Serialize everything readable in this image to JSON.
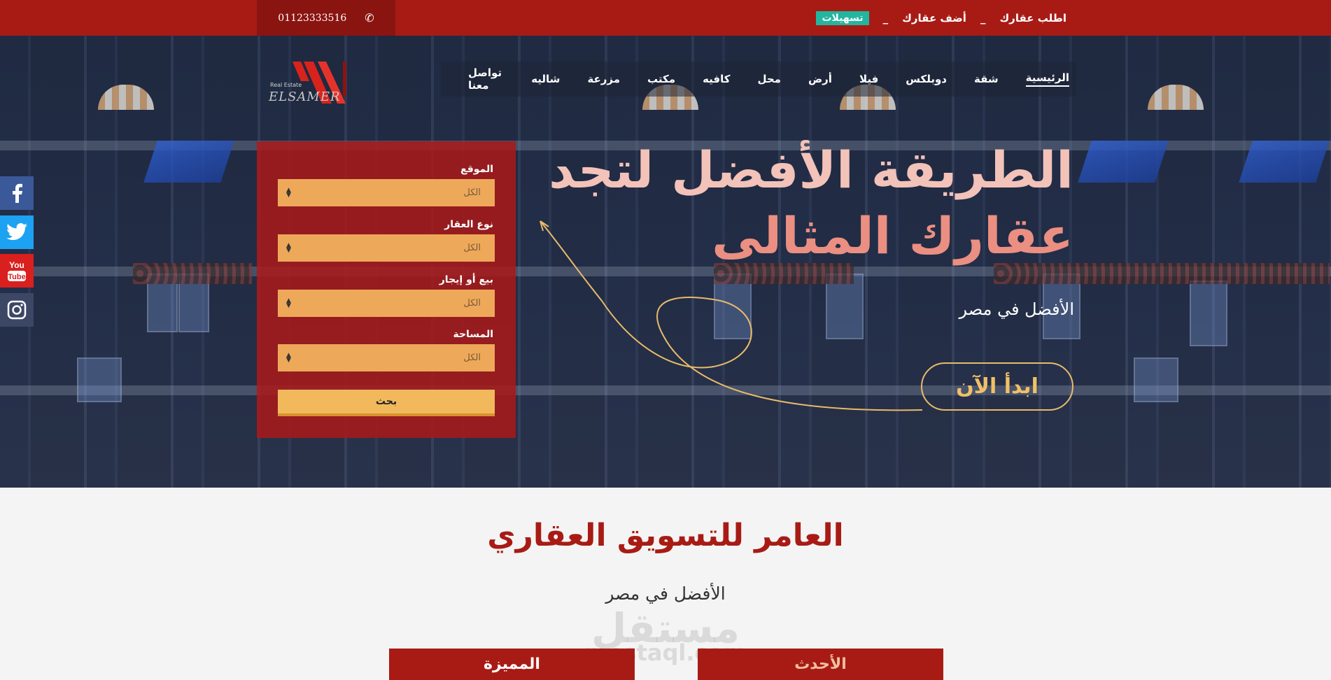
{
  "topbar": {
    "phone": "01123333516",
    "links": [
      "اطلب عقارك",
      "أضف عقارك"
    ],
    "separator": "_",
    "badge": "تسهيلات"
  },
  "logo": {
    "text": "ELSAMER",
    "small": "Real Estate"
  },
  "nav": {
    "items": [
      "الرئيسية",
      "شقة",
      "دوبلكس",
      "فيلا",
      "أرض",
      "محل",
      "كافيه",
      "مكتب",
      "مزرعة",
      "شاليه",
      "تواصل معنا"
    ]
  },
  "social": [
    "facebook-icon",
    "twitter-icon",
    "youtube-icon",
    "instagram-icon"
  ],
  "search": {
    "fields": [
      {
        "label": "الموقع",
        "value": "الكل"
      },
      {
        "label": "نوع العقار",
        "value": "الكل"
      },
      {
        "label": "بيع أو إيجار",
        "value": "الكل"
      },
      {
        "label": "المساحة",
        "value": "الكل"
      }
    ],
    "button": "بحث"
  },
  "hero": {
    "line1": "الطريقة الأفضل لتجد",
    "line2": "عقارك المثالى",
    "sub": "الأفضل في مصر",
    "cta": "ابدأ الآن"
  },
  "section": {
    "title": "العامر للتسويق العقاري",
    "sub": "الأفضل في مصر",
    "watermark": "مستقل",
    "watermark_url": "mostaql.com",
    "tabs": [
      "الأحدث",
      "المميزة"
    ]
  },
  "colors": {
    "brand_red": "#a81b15",
    "accent_orange": "#f1b95c",
    "teal": "#22b6a0"
  }
}
